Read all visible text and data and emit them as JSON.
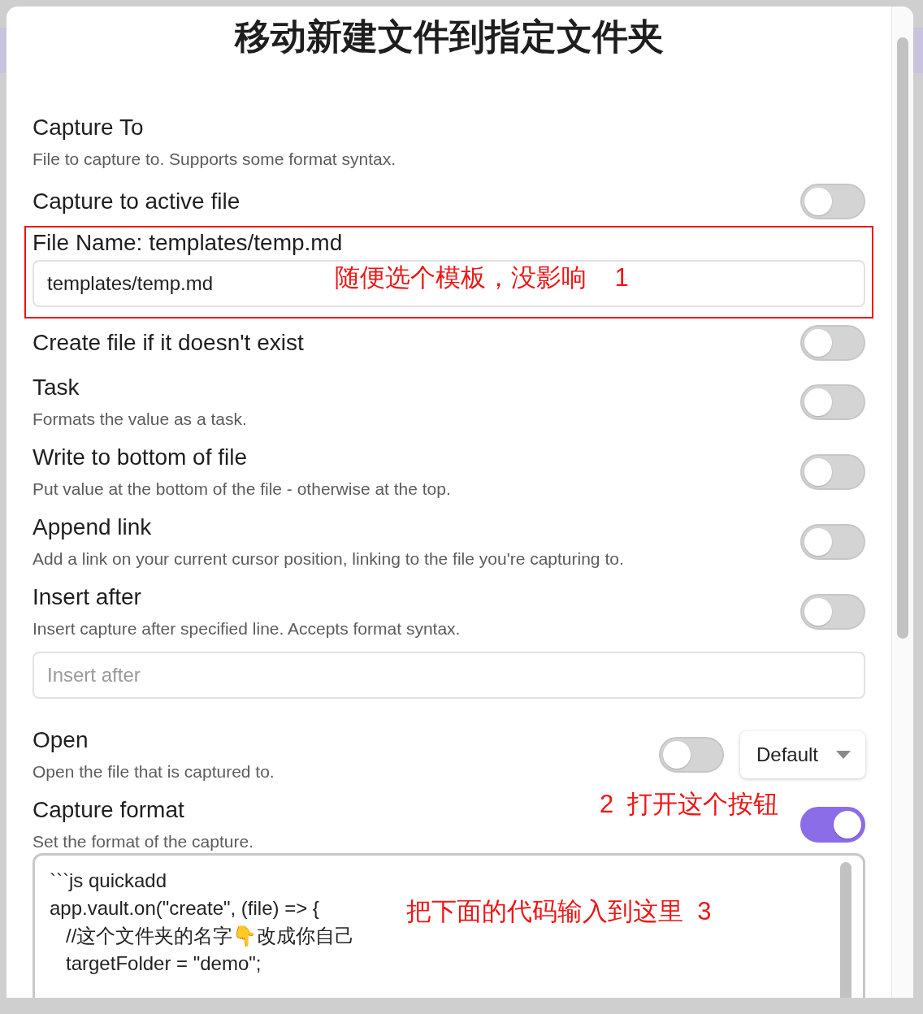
{
  "modal": {
    "title": "移动新建文件到指定文件夹"
  },
  "settings": [
    {
      "kind": "info",
      "name": "Capture To",
      "description": "File to capture to. Supports some format syntax."
    },
    {
      "kind": "toggle",
      "name": "Capture to active file",
      "on": false
    },
    {
      "kind": "input",
      "name": "File Name: templates/temp.md",
      "value": "templates/temp.md",
      "highlighted": true,
      "annotation": "随便选个模板，没影响    1"
    },
    {
      "kind": "toggle",
      "name": "Create file if it doesn't exist",
      "on": false
    },
    {
      "kind": "toggle",
      "name": "Task",
      "description": "Formats the value as a task.",
      "on": false
    },
    {
      "kind": "toggle",
      "name": "Write to bottom of file",
      "description": "Put value at the bottom of the file - otherwise at the top.",
      "on": false
    },
    {
      "kind": "toggle",
      "name": "Append link",
      "description": "Add a link on your current cursor position, linking to the file you're capturing to.",
      "on": false
    },
    {
      "kind": "toggle-input",
      "name": "Insert after",
      "description": "Insert capture after specified line. Accepts format syntax.",
      "on": false,
      "placeholder": "Insert after"
    },
    {
      "kind": "toggle-dropdown",
      "name": "Open",
      "description": "Open the file that is captured to.",
      "on": false,
      "dropdown": "Default"
    },
    {
      "kind": "toggle-textarea",
      "name": "Capture format",
      "description": "Set the format of the capture.",
      "on": true,
      "annotation": "2  打开这个按钮",
      "value": "```js quickadd\napp.vault.on(\"create\", (file) => {\n   //这个文件夹的名字👇改成你自己\n   targetFolder = \"demo\";",
      "value_annotation": "把下面的代码输入到这里  3"
    }
  ]
}
